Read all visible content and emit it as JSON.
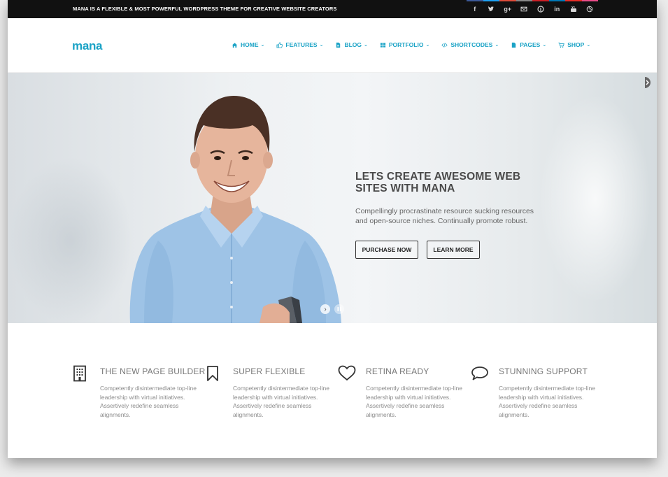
{
  "topbar": {
    "tagline": "MANA IS A FLEXIBLE & MOST POWERFUL WORDPRESS THEME FOR CREATIVE WEBSITE CREATORS",
    "social": [
      {
        "name": "facebook-icon",
        "glyph": "f",
        "color": "#3b5998"
      },
      {
        "name": "twitter-icon",
        "glyph": "t",
        "color": "#1da1f2"
      },
      {
        "name": "googleplus-icon",
        "glyph": "g+",
        "color": "#dd4b39"
      },
      {
        "name": "email-icon",
        "glyph": "✉",
        "color": "#888888"
      },
      {
        "name": "pinterest-icon",
        "glyph": "p",
        "color": "#cb2027"
      },
      {
        "name": "linkedin-icon",
        "glyph": "in",
        "color": "#0077b5"
      },
      {
        "name": "youtube-icon",
        "glyph": "▶",
        "color": "#e52d27"
      },
      {
        "name": "dribbble-icon",
        "glyph": "◎",
        "color": "#ea4c89"
      }
    ]
  },
  "header": {
    "logo": "mana",
    "nav": [
      {
        "label": "HOME",
        "icon": "home-icon"
      },
      {
        "label": "FEATURES",
        "icon": "thumbs-up-icon"
      },
      {
        "label": "BLOG",
        "icon": "document-icon"
      },
      {
        "label": "PORTFOLIO",
        "icon": "grid-icon"
      },
      {
        "label": "SHORTCODES",
        "icon": "code-icon"
      },
      {
        "label": "PAGES",
        "icon": "page-icon"
      },
      {
        "label": "SHOP",
        "icon": "cart-icon"
      }
    ]
  },
  "hero": {
    "title": "LETS CREATE AWESOME WEB SITES WITH MANA",
    "subtitle": "Compellingly procrastinate resource sucking resources and open-source niches. Continually promote robust.",
    "purchase_label": "PURCHASE NOW",
    "learn_label": "LEARN MORE"
  },
  "features": [
    {
      "title": "THE NEW PAGE BUILDER",
      "icon": "building-icon",
      "text": "Competently disintermediate top-line leadership with virtual initiatives. Assertively redefine seamless alignments."
    },
    {
      "title": "SUPER FLEXIBLE",
      "icon": "bookmark-icon",
      "text": "Competently disintermediate top-line leadership with virtual initiatives. Assertively redefine seamless alignments."
    },
    {
      "title": "RETINA READY",
      "icon": "heart-icon",
      "text": "Competently disintermediate top-line leadership with virtual initiatives. Assertively redefine seamless alignments."
    },
    {
      "title": "STUNNING SUPPORT",
      "icon": "speech-bubble-icon",
      "text": "Competently disintermediate top-line leadership with virtual initiatives. Assertively redefine seamless alignments."
    }
  ],
  "colors": {
    "accent": "#1ba3c6",
    "topbar": "#111111"
  }
}
